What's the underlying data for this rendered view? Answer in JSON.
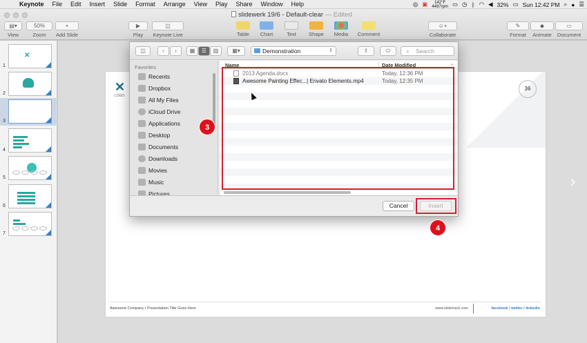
{
  "menubar": {
    "app": "Keynote",
    "items": [
      "File",
      "Edit",
      "Insert",
      "Slide",
      "Format",
      "Arrange",
      "View",
      "Play",
      "Share",
      "Window",
      "Help"
    ],
    "temp_line1": "142°F",
    "temp_line2": "4497rpm",
    "battery": "32%",
    "clock": "Sun 12:42 PM"
  },
  "window": {
    "title": "slidewerk 19/6 - Default-clear",
    "edited": "— Edited",
    "zoom": "50%"
  },
  "toolbar": {
    "view": "View",
    "zoom": "Zoom",
    "add_slide": "Add Slide",
    "play": "Play",
    "keynote_live": "Keynote Live",
    "table": "Table",
    "chart": "Chart",
    "text": "Text",
    "shape": "Shape",
    "media": "Media",
    "comment": "Comment",
    "collaborate": "Collaborate",
    "format": "Format",
    "animate": "Animate",
    "document": "Document"
  },
  "slides": {
    "numbers": [
      "1",
      "2",
      "3",
      "4",
      "5",
      "6",
      "7"
    ],
    "selected_index": 3
  },
  "slide": {
    "logo": "✕",
    "logo_text": "LOGO",
    "page_number": "36",
    "footer_left": "Awesome Company • Presentation Title Goes Here",
    "footer_mid": "www.slidehack.com",
    "footer_right": "facebook / twitter / linkedin"
  },
  "dialog": {
    "location": "Demonstration",
    "search_placeholder": "Search",
    "favorites_header": "Favorites",
    "favorites": [
      "Recents",
      "Dropbox",
      "All My Files",
      "iCloud Drive",
      "Applications",
      "Desktop",
      "Documents",
      "Downloads",
      "Movies",
      "Music",
      "Pictures"
    ],
    "columns": {
      "name": "Name",
      "date": "Date Modified"
    },
    "files": [
      {
        "name": "2013 Agenda.docx",
        "date": "Today, 12:36 PM"
      },
      {
        "name": "Awesome Painting Effec...| Envato Elements.mp4",
        "date": "Today, 12:35 PM"
      }
    ],
    "cancel": "Cancel",
    "insert": "Insert"
  },
  "annotations": {
    "badge_files": "3",
    "badge_insert": "4"
  },
  "colors": {
    "highlight": "#d0202f",
    "badge": "#e0101a",
    "accent": "#26a9a1"
  }
}
